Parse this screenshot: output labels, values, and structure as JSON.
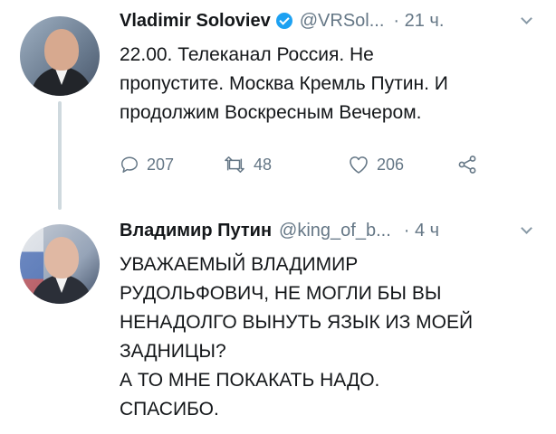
{
  "tweets": [
    {
      "name": "Vladimir Soloviev",
      "verified": true,
      "handle": "@VRSol...",
      "time": "· 21 ч.",
      "lines": [
        "22.00. Телеканал Россия. Не",
        "пропустите. Москва Кремль Путин. И",
        "продолжим Воскресным Вечером."
      ],
      "actions": {
        "replies": "207",
        "retweets": "48",
        "likes": "206"
      }
    },
    {
      "name": "Владимир Путин",
      "verified": false,
      "handle": "@king_of_b...",
      "time": "· 4 ч",
      "lines": [
        "УВАЖАЕМЫЙ ВЛАДИМИР",
        "РУДОЛЬФОВИЧ, НЕ МОГЛИ БЫ ВЫ",
        "НЕНАДОЛГО ВЫНУТЬ ЯЗЫК ИЗ МОЕЙ",
        "ЗАДНИЦЫ?",
        "А ТО МНЕ ПОКАКАТЬ НАДО.",
        "СПАСИБО."
      ]
    }
  ],
  "icons": {
    "reply": "reply-icon",
    "retweet": "retweet-icon",
    "like": "heart-icon",
    "share": "share-icon",
    "more": "chevron-down-icon",
    "verified": "verified-badge-icon"
  },
  "colors": {
    "text": "#14171a",
    "secondary": "#657786",
    "verified": "#1da1f2",
    "thread_line": "#cfd9de"
  }
}
